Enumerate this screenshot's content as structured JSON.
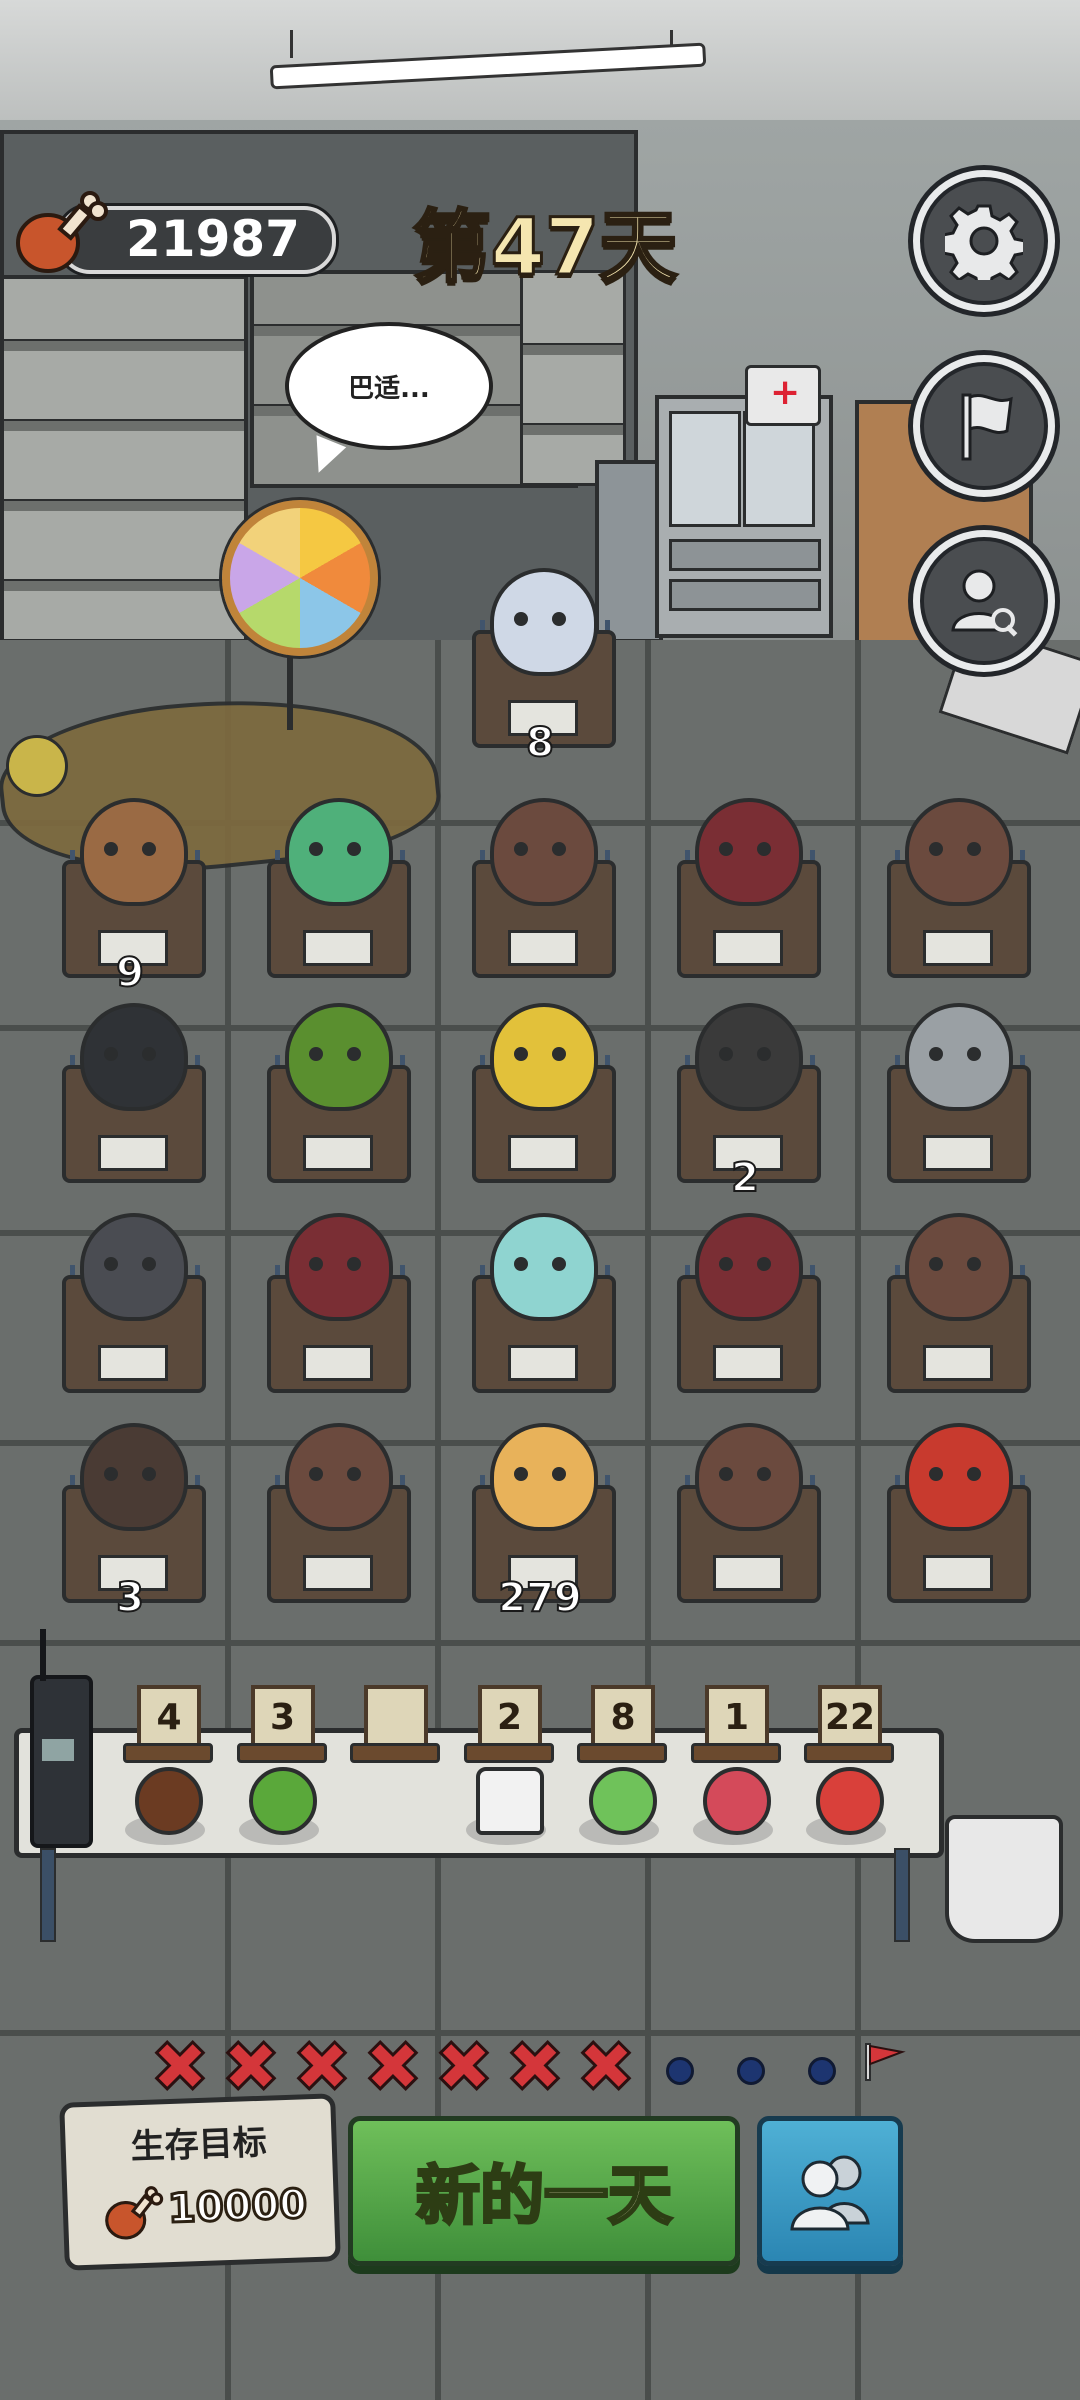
{
  "header": {
    "meat_count": "21987",
    "day_label": "第47天",
    "speech_bubble": "巴适..."
  },
  "desks": [
    {
      "row": 0,
      "col": 2,
      "character": "silver-haired-girl",
      "count": "8",
      "color": "#cfd8e6"
    },
    {
      "row": 1,
      "col": 0,
      "character": "bearded-man",
      "count": "9",
      "color": "#9a6a44"
    },
    {
      "row": 1,
      "col": 1,
      "character": "green-frog",
      "count": "",
      "color": "#4fb07a"
    },
    {
      "row": 1,
      "col": 2,
      "character": "ponytail-girl",
      "count": "",
      "color": "#6b4a3e"
    },
    {
      "row": 1,
      "col": 3,
      "character": "hooded-glasses-girl",
      "count": "",
      "color": "#7a2e34"
    },
    {
      "row": 1,
      "col": 4,
      "character": "ponytail-girl",
      "count": "",
      "color": "#6b4a3e"
    },
    {
      "row": 2,
      "col": 0,
      "character": "black-haired-boy",
      "count": "",
      "color": "#2f3236"
    },
    {
      "row": 2,
      "col": 1,
      "character": "watermelon-hat-kid",
      "count": "",
      "color": "#5a8f2f"
    },
    {
      "row": 2,
      "col": 2,
      "character": "blonde-demon",
      "count": "",
      "color": "#e2c13a"
    },
    {
      "row": 2,
      "col": 3,
      "character": "lightning-hair-girl",
      "count": "2",
      "color": "#3a3a3a"
    },
    {
      "row": 2,
      "col": 4,
      "character": "skeleton-robot",
      "count": "",
      "color": "#9aa0a4"
    },
    {
      "row": 3,
      "col": 0,
      "character": "smoking-girl",
      "count": "",
      "color": "#4a4c52"
    },
    {
      "row": 3,
      "col": 1,
      "character": "hooded-glasses-girl",
      "count": "",
      "color": "#7a2e34"
    },
    {
      "row": 3,
      "col": 2,
      "character": "cyan-cat-beast",
      "count": "",
      "color": "#8fd4d0"
    },
    {
      "row": 3,
      "col": 3,
      "character": "hooded-glasses-girl",
      "count": "",
      "color": "#7a2e34"
    },
    {
      "row": 3,
      "col": 4,
      "character": "ponytail-girl",
      "count": "",
      "color": "#6b4a3e"
    },
    {
      "row": 4,
      "col": 0,
      "character": "topknot-man",
      "count": "3",
      "color": "#4a3b34"
    },
    {
      "row": 4,
      "col": 1,
      "character": "ponytail-girl",
      "count": "",
      "color": "#6b4a3e"
    },
    {
      "row": 4,
      "col": 2,
      "character": "bunny-eared-monk",
      "count": "279",
      "color": "#e8b25a"
    },
    {
      "row": 4,
      "col": 3,
      "character": "ponytail-girl",
      "count": "",
      "color": "#6b4a3e"
    },
    {
      "row": 4,
      "col": 4,
      "character": "sunglasses-boss",
      "count": "",
      "color": "#c83a2e"
    }
  ],
  "items": [
    {
      "count": "4",
      "icon": "cookies-icon",
      "color": "#6b3b22"
    },
    {
      "count": "3",
      "icon": "herb-leaves-icon",
      "color": "#5aa83a"
    },
    {
      "count": "",
      "icon": "empty-slot",
      "color": ""
    },
    {
      "count": "2",
      "icon": "milk-bottle-icon",
      "color": "#f2f2f2"
    },
    {
      "count": "8",
      "icon": "frog-icon",
      "color": "#6fc25a"
    },
    {
      "count": "1",
      "icon": "red-crystal-icon",
      "color": "#d44a5a"
    },
    {
      "count": "22",
      "icon": "watermelon-icon",
      "color": "#d9403a"
    }
  ],
  "progress": {
    "completed_days": 7,
    "remaining_days": 3,
    "goal_icon": "red-flag-icon"
  },
  "bottom": {
    "goal_title": "生存目标",
    "goal_value": "10000",
    "new_day_label": "新的一天",
    "friends_icon": "people-icon"
  },
  "colors": {
    "accent_green": "#4a9c43",
    "accent_blue": "#3496c4",
    "x_red": "#d4363a",
    "day_title": "#f5e6b0"
  }
}
